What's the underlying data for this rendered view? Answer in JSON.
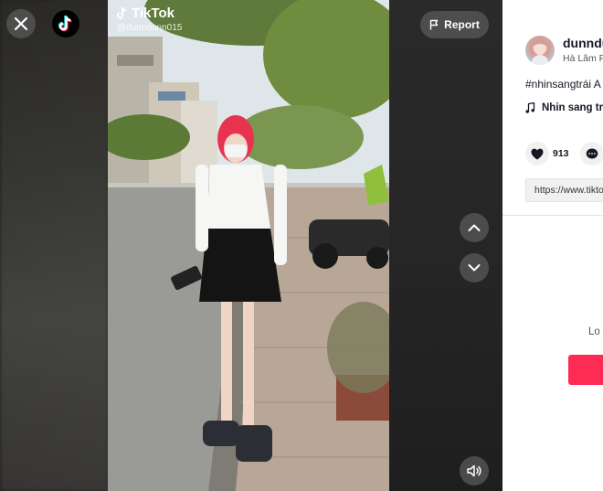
{
  "player": {
    "watermark_brand": "TikTok",
    "watermark_user": "@dunndunn015",
    "report_label": "Report"
  },
  "author": {
    "name": "dunndu",
    "subtitle": "Hà Lâm P"
  },
  "video_info": {
    "caption": "#nhinsangtrái A",
    "music": "Nhin sang tr",
    "likes": "913",
    "link": "https://www.tikto"
  },
  "login": {
    "text": "Lo"
  },
  "colors": {
    "accent": "#fe2c55",
    "panel_bg": "#ffffff",
    "overlay_btn": "#5a5a5a"
  },
  "icons": [
    "close-icon",
    "tiktok-logo-icon",
    "flag-icon",
    "chevron-up-icon",
    "chevron-down-icon",
    "volume-icon",
    "heart-icon",
    "comment-icon",
    "music-note-icon"
  ]
}
